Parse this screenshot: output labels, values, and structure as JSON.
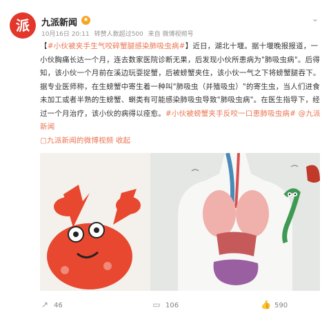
{
  "author": {
    "name": "九派新闻",
    "meta_date": "10月16日 20:11",
    "meta_forward_label": "转赞人数超过500",
    "meta_source": "来自 微博视频号"
  },
  "post": {
    "bracket_open": "【",
    "topic": "#小伙被夹手生气咬碎蟹腿感染肺吸虫病#",
    "bracket_close": "】",
    "text_main": "近日，湖北十堰。据十堰晚报报道，一小伙胸痛长达一个月，连去数家医院诊断无果，后发现小伙所患病为\"肺吸虫病\"。后得知，该小伙一个月前在溪边玩耍捉蟹，后被螃蟹夹住，该小伙一气之下将螃蟹腿吞下。据专业医师称，在生螃蟹中寄生着一种叫\"肺吸虫（并殖吸虫）\"的寄生虫，当人们进食未加工或者半熟的生螃蟹、蝲类有可能感染肺吸虫导致\"肺吸虫病\"。在医生指导下，经过一个月治疗，该小伙的病得以痊愈。",
    "topic2": "#小伙被螃蟹夹手反咬一口患肺吸虫病#",
    "mention": "@九派新闻",
    "video_link": "九派新闻的微博视频",
    "collapse": "收起"
  },
  "actions": {
    "share_count": "46",
    "comment_count": "106",
    "like_count": "590"
  },
  "colors": {
    "accent": "#eb7350",
    "avatar": "#e2372a"
  }
}
